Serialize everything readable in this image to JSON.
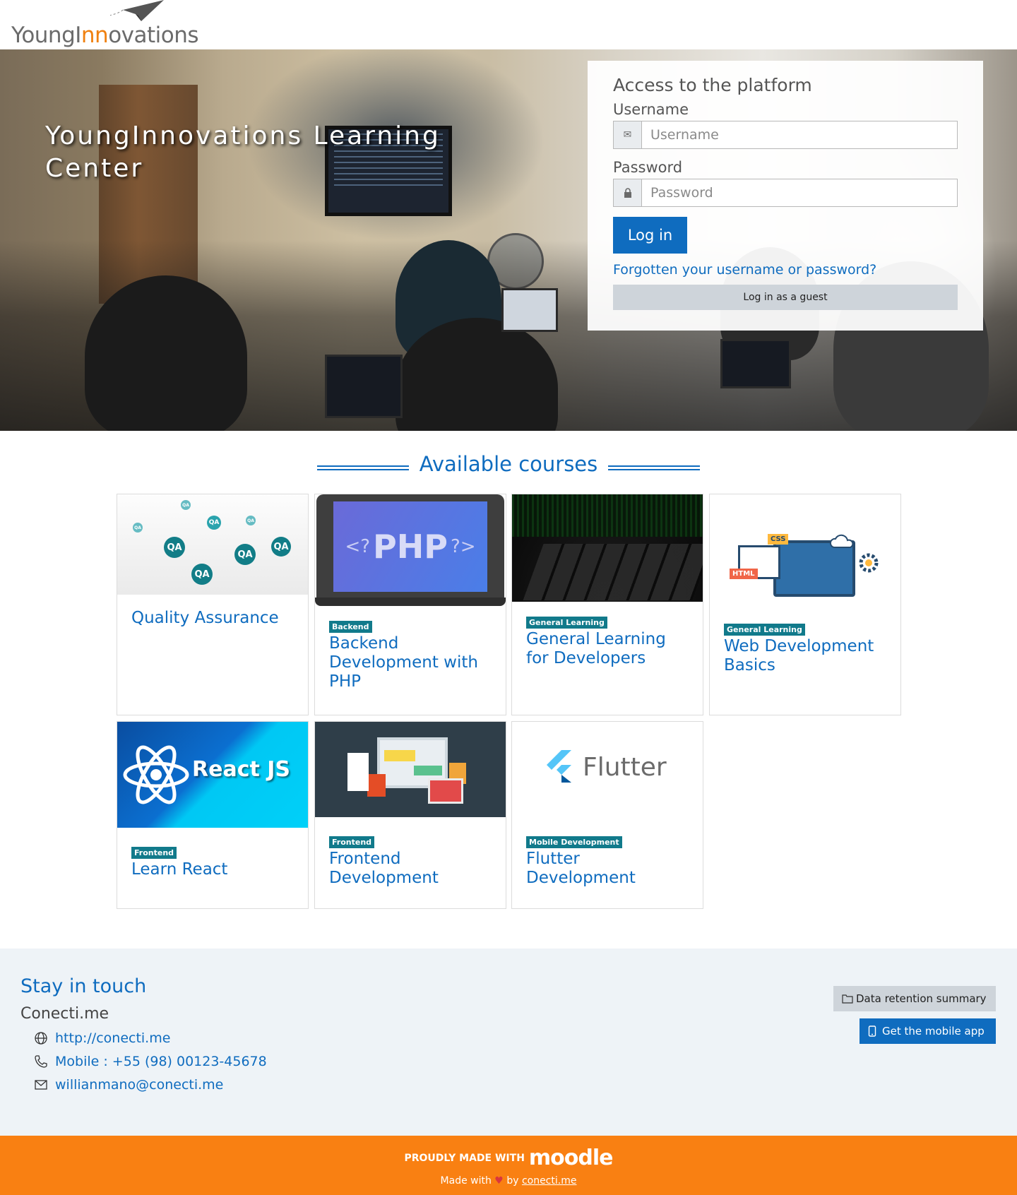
{
  "header": {
    "logo_prefix": "YoungI",
    "logo_highlight": "nn",
    "logo_suffix": "ovations"
  },
  "hero": {
    "title": "YoungInnovations Learning Center"
  },
  "login": {
    "heading": "Access to the platform",
    "username_label": "Username",
    "username_placeholder": "Username",
    "password_label": "Password",
    "password_placeholder": "Password",
    "login_button": "Log in",
    "forgot_link": "Forgotten your username or password?",
    "guest_button": "Log in as a guest"
  },
  "courses": {
    "title": "Available courses",
    "items": [
      {
        "category": "",
        "name": "Quality Assurance"
      },
      {
        "category": "Backend",
        "name": "Backend Development with PHP"
      },
      {
        "category": "General Learning",
        "name": "General Learning for Developers"
      },
      {
        "category": "General Learning",
        "name": "Web Development Basics"
      },
      {
        "category": "Frontend",
        "name": "Learn React"
      },
      {
        "category": "Frontend",
        "name": "Frontend Development"
      },
      {
        "category": "Mobile Development",
        "name": "Flutter Development"
      }
    ],
    "image_text": {
      "qa": "QA",
      "php": "PHP",
      "react": "React JS",
      "flutter": "Flutter",
      "html": "HTML",
      "css": "CSS"
    }
  },
  "footer": {
    "heading": "Stay in touch",
    "org": "Conecti.me",
    "website": "http://conecti.me",
    "phone": "Mobile : +55 (98) 00123-45678",
    "email": "willianmano@conecti.me",
    "data_retention": "Data retention summary",
    "mobile_app": "Get the mobile app"
  },
  "bottombar": {
    "made_with": "PROUDLY MADE WITH",
    "moodle": "moodle",
    "credit_prefix": "Made with",
    "credit_by": "by",
    "credit_link": "conecti.me"
  },
  "colors": {
    "primary": "#0f6cbf",
    "badge": "#117a8b",
    "footer_bar": "#f98012",
    "logo_accent": "#f0800f"
  }
}
